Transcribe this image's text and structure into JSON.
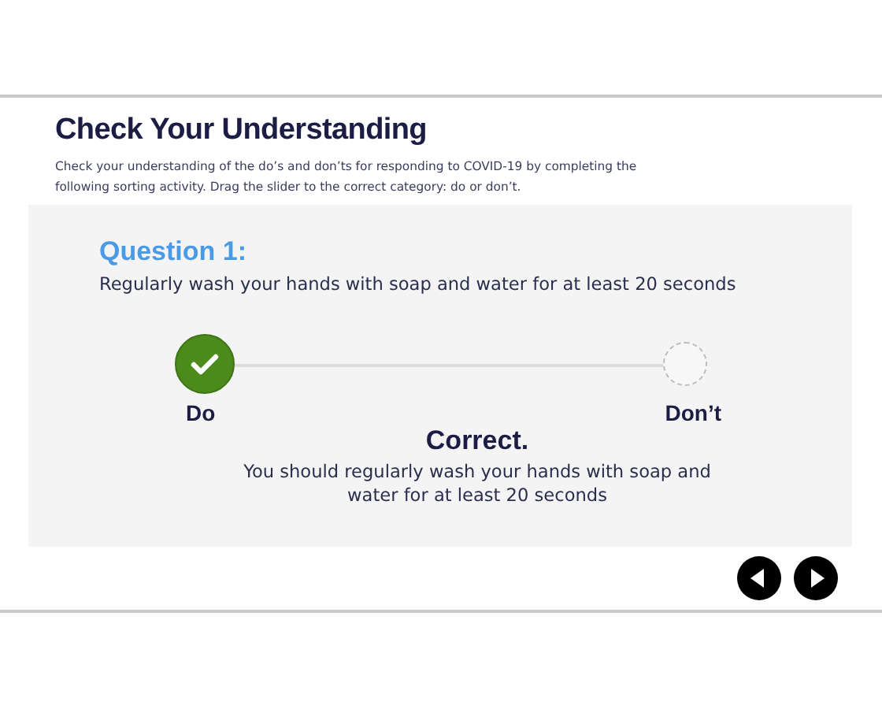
{
  "title": "Check Your Understanding",
  "instructions": "Check your understanding of the do’s and don’ts for responding to COVID-19 by completing the following sorting activity. Drag the slider to the correct category: do or don’t.",
  "question": {
    "number": "Question 1:",
    "text": "Regularly wash your hands with soap and water for at least 20 seconds"
  },
  "slider": {
    "level": 0,
    "options": [
      {
        "label": "Do"
      },
      {
        "label": "Don’t"
      }
    ]
  },
  "feedback": {
    "heading": "Correct.",
    "text": "You should regularly wash your hands with soap and water for at least 20 seconds"
  },
  "nav": [
    {
      "kind": "previous"
    },
    {
      "kind": "next"
    }
  ]
}
